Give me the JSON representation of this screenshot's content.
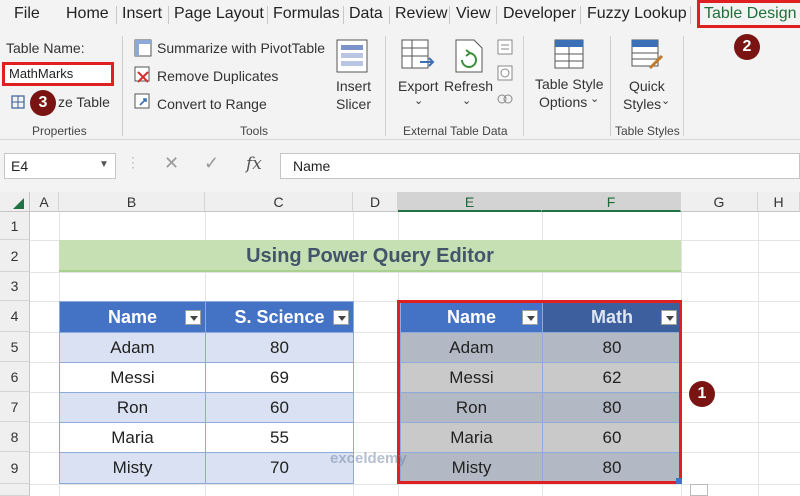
{
  "menu": {
    "items": [
      "File",
      "Home",
      "Insert",
      "Page Layout",
      "Formulas",
      "Data",
      "Review",
      "View",
      "Developer",
      "Fuzzy Lookup"
    ],
    "active": "Table Design"
  },
  "ribbon": {
    "properties": {
      "table_name_label": "Table Name:",
      "table_name_value": "MathMarks",
      "resize_label": "ze Table",
      "group_label": "Properties"
    },
    "tools": {
      "summarize": "Summarize with PivotTable",
      "remove_duplicates": "Remove Duplicates",
      "convert_to_range": "Convert to Range",
      "insert_slicer_1": "Insert",
      "insert_slicer_2": "Slicer",
      "group_label": "Tools"
    },
    "external": {
      "export": "Export",
      "refresh": "Refresh",
      "group_label": "External Table Data"
    },
    "style_options": {
      "label_1": "Table Style",
      "label_2": "Options"
    },
    "table_styles": {
      "label_1": "Quick",
      "label_2": "Styles",
      "group_label": "Table Styles"
    }
  },
  "badges": {
    "one": "1",
    "two": "2",
    "three": "3"
  },
  "formula_bar": {
    "name_box": "E4",
    "cancel_glyph": "✕",
    "enter_glyph": "✓",
    "fx": "fx",
    "content": "Name"
  },
  "grid": {
    "columns": [
      "A",
      "B",
      "C",
      "D",
      "E",
      "F",
      "G",
      "H"
    ],
    "rows": [
      "1",
      "2",
      "3",
      "4",
      "5",
      "6",
      "7",
      "8",
      "9"
    ],
    "title": "Using Power Query Editor"
  },
  "table1": {
    "headers": [
      "Name",
      "S. Science"
    ],
    "rows": [
      [
        "Adam",
        "80"
      ],
      [
        "Messi",
        "69"
      ],
      [
        "Ron",
        "60"
      ],
      [
        "Maria",
        "55"
      ],
      [
        "Misty",
        "70"
      ]
    ]
  },
  "table2": {
    "headers": [
      "Name",
      "Math"
    ],
    "rows": [
      [
        "Adam",
        "80"
      ],
      [
        "Messi",
        "62"
      ],
      [
        "Ron",
        "80"
      ],
      [
        "Maria",
        "60"
      ],
      [
        "Misty",
        "80"
      ]
    ]
  },
  "watermark": "exceldemy",
  "colors": {
    "accent_red": "#e02020",
    "excel_green": "#217346",
    "table_header_blue": "#4472c4",
    "title_band_green": "#c6e0b4"
  }
}
